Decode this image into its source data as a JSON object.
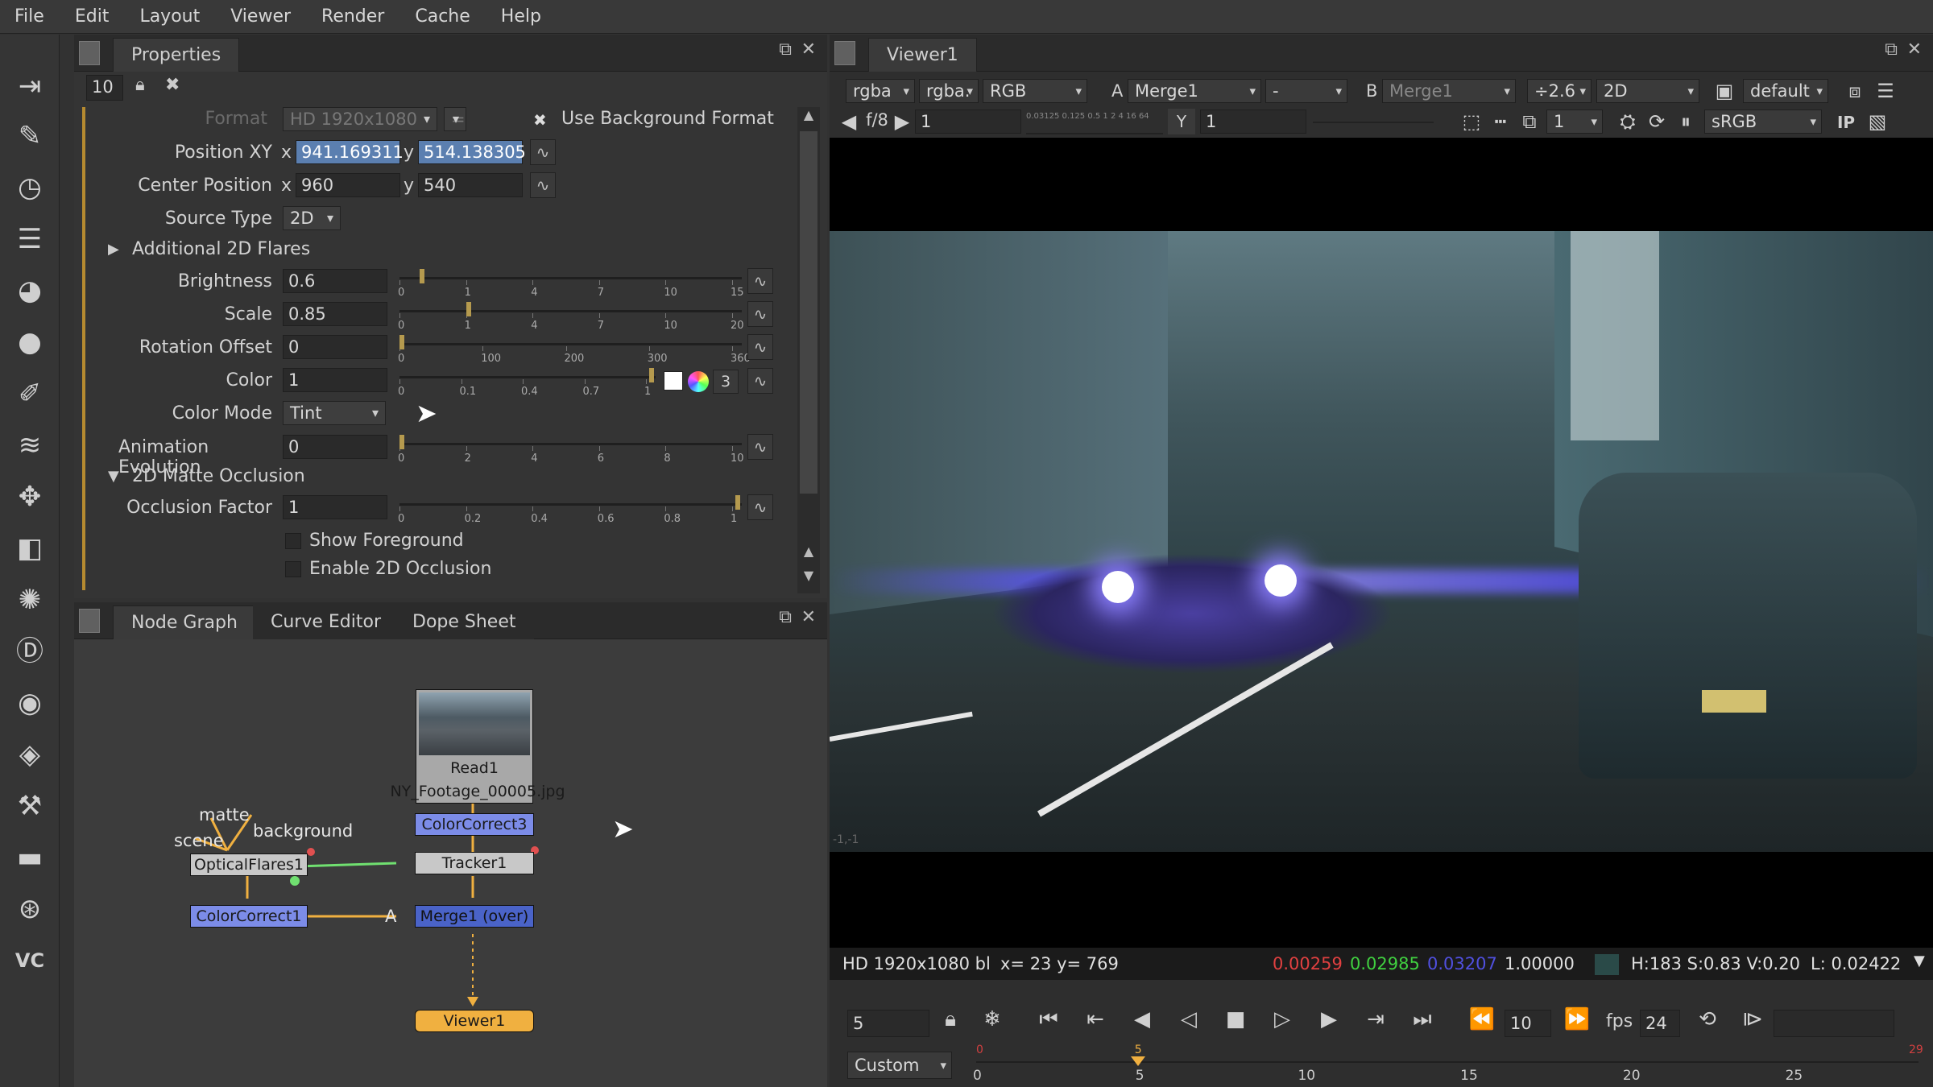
{
  "menu": [
    "File",
    "Edit",
    "Layout",
    "Viewer",
    "Render",
    "Cache",
    "Help"
  ],
  "toolbar_icons": [
    "input-icon",
    "brush-icon",
    "clock-icon",
    "channel-icon",
    "color-icon",
    "filter-icon",
    "keyer-icon",
    "merge-icon",
    "transform-icon",
    "3d-icon",
    "particles-icon",
    "deep-icon",
    "views-icon",
    "metadata-icon",
    "toolsets-icon",
    "other-icon",
    "furnace-icon",
    "vc-icon"
  ],
  "toolbar_vc": "VC",
  "properties": {
    "tab": "Properties",
    "count": "10",
    "format_label": "Format",
    "format_value": "HD 1920x1080",
    "format_eq": "=",
    "use_bg_format": "Use Background Format",
    "position_label": "Position XY",
    "x_label": "x",
    "y_label": "y",
    "position_x": "941.169311",
    "position_y": "514.138305",
    "center_label": "Center Position",
    "center_x": "960",
    "center_y": "540",
    "source_type_label": "Source Type",
    "source_type": "2D",
    "additional_flares": "Additional 2D Flares",
    "brightness_label": "Brightness",
    "brightness": "0.6",
    "brightness_level": 0.06,
    "brightness_ticks": [
      "0",
      "1",
      "4",
      "7",
      "10",
      "15"
    ],
    "scale_label": "Scale",
    "scale": "0.85",
    "scale_level": 0.2,
    "scale_ticks": [
      "0",
      "1",
      "4",
      "7",
      "10",
      "20"
    ],
    "rotation_label": "Rotation Offset",
    "rotation": "0",
    "rotation_level": 0,
    "rotation_ticks": [
      "0",
      "100",
      "200",
      "300",
      "360"
    ],
    "color_label": "Color",
    "color": "1",
    "color_level": 1,
    "color_ticks": [
      "0",
      "0.1",
      "0.4",
      "0.7",
      "1"
    ],
    "color_channels": "3",
    "color_mode_label": "Color Mode",
    "color_mode": "Tint",
    "anim_label": "Animation Evolution",
    "anim": "0",
    "anim_level": 0,
    "anim_ticks": [
      "0",
      "2",
      "4",
      "6",
      "8",
      "10"
    ],
    "matte_section": "2D Matte Occlusion",
    "occlusion_label": "Occlusion Factor",
    "occlusion": "1",
    "occlusion_level": 1,
    "occlusion_ticks": [
      "0",
      "0.2",
      "0.4",
      "0.6",
      "0.8",
      "1"
    ],
    "show_foreground": "Show Foreground",
    "enable_occlusion": "Enable 2D Occlusion"
  },
  "node_graph": {
    "tabs": [
      "Node Graph",
      "Curve Editor",
      "Dope Sheet"
    ],
    "read_label": "Read1",
    "read_file": "NY_Footage_00005.jpg",
    "colorcorrect3": "ColorCorrect3",
    "tracker": "Tracker1",
    "opticalflares": "OpticalFlares1",
    "colorcorrect1": "ColorCorrect1",
    "merge": "Merge1 (over)",
    "viewer": "Viewer1",
    "input_matte": "matte",
    "input_scene": "scene",
    "input_background": "background",
    "input_a": "A"
  },
  "viewer": {
    "tab": "Viewer1",
    "channels": "rgba",
    "alpha": "rgba.",
    "display": "RGB",
    "a_label": "A",
    "a_input": "Merge1",
    "op": "-",
    "b_label": "B",
    "b_input": "Merge1",
    "gain": "÷2.6",
    "mode": "2D",
    "lut": "default",
    "fstop": "f/8",
    "gain_value": "1",
    "gain_scale": "0.03125 0.125  0.5  1  2  4  16 64",
    "gamma_label": "Y",
    "gamma_value": "1",
    "proxy": "1",
    "colorspace": "sRGB",
    "ip": "IP",
    "info_format": "HD 1920x1080 bl",
    "info_xy": "x=   23 y= 769",
    "info_r": "0.00259",
    "info_g": "0.02985",
    "info_b": "0.03207",
    "info_a": "1.00000",
    "info_hsv": "H:183 S:0.83 V:0.20",
    "info_l": "L: 0.02422",
    "corner_label": "-1,-1"
  },
  "timeline": {
    "frame": "5",
    "skip": "10",
    "fps_label": "fps",
    "fps": "24",
    "range": "Custom",
    "in_frame": "0",
    "out_frame": "29",
    "current_marker": "5",
    "current_fraction": 0.172,
    "ticks": [
      "0",
      "5",
      "10",
      "15",
      "20",
      "25"
    ]
  },
  "colors": {
    "accent_selection": "#5b7fb0",
    "node_read": "#a8a8a8",
    "node_color": "#7c8ce8",
    "node_merge": "#4a63c8",
    "node_viewer": "#f0b040",
    "edge": "#f0b040",
    "info_red": "#e04040",
    "info_green": "#40d040",
    "info_blue": "#5050e0"
  }
}
